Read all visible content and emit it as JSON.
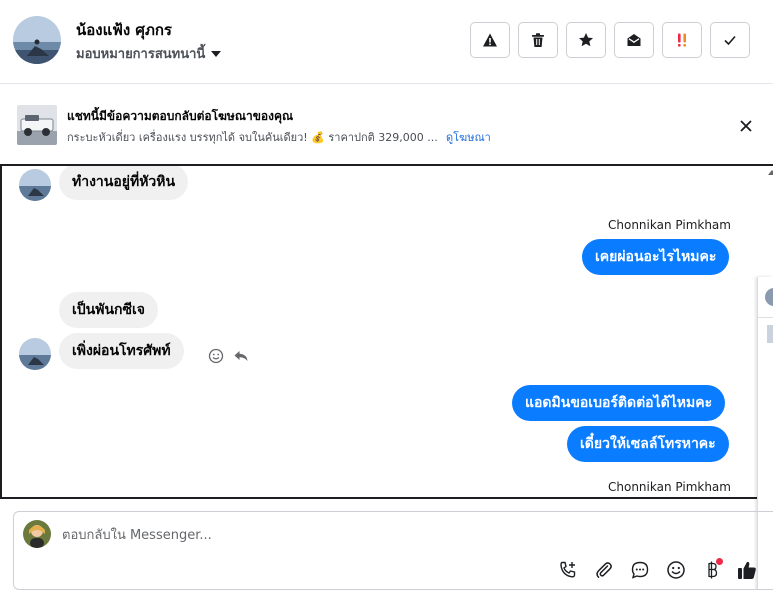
{
  "header": {
    "contact_name": "น้องแฟ้ง ศุภกร",
    "assign_label": "มอบหมายการสนทนานี้",
    "actions": [
      {
        "name": "report-spam-button",
        "icon": "warning-icon"
      },
      {
        "name": "delete-button",
        "icon": "trash-icon"
      },
      {
        "name": "star-button",
        "icon": "star-icon"
      },
      {
        "name": "mark-unread-button",
        "icon": "envelope-open-icon"
      },
      {
        "name": "mark-urgent-button",
        "icon": "double-exclamation-icon"
      },
      {
        "name": "mark-done-button",
        "icon": "check-icon"
      }
    ]
  },
  "ad_banner": {
    "title": "แชทนี้มีข้อความตอบกลับต่อโฆษณาของคุณ",
    "description": "กระบะหัวเดี่ยว เครื่องแรง บรรทุกได้ จบในคันเดียว! 💰 ราคาปกติ 329,000 ...",
    "link": "ดูโฆษณา"
  },
  "messages": [
    {
      "direction": "in",
      "text": "ทำงานอยู่ที่หัวหิน"
    },
    {
      "direction": "out",
      "sender": "Chonnikan Pimkham",
      "text": "เคยผ่อนอะไรไหมคะ"
    },
    {
      "direction": "in",
      "text": "เป็นพันกซีเจ"
    },
    {
      "direction": "in",
      "text": "เพิ่งผ่อนโทรศัพท์"
    },
    {
      "direction": "out",
      "text": "แอดมินขอเบอร์ติดต่อได้ไหมคะ"
    },
    {
      "direction": "out",
      "text": "เดี๋ยวให้เซลล์โทรหาคะ"
    },
    {
      "direction": "out",
      "sender": "Chonnikan Pimkham"
    }
  ],
  "composer": {
    "placeholder": "ตอบกลับใน Messenger...",
    "tools": [
      "add-call-icon",
      "paperclip-icon",
      "saved-reply-icon",
      "emoji-icon",
      "baht-icon",
      "thumbs-up-icon"
    ]
  },
  "colors": {
    "outgoing_bubble": "#0a7cff",
    "incoming_bubble": "#f0f0f0",
    "link": "#216fdb",
    "urgent": "#f02849"
  }
}
